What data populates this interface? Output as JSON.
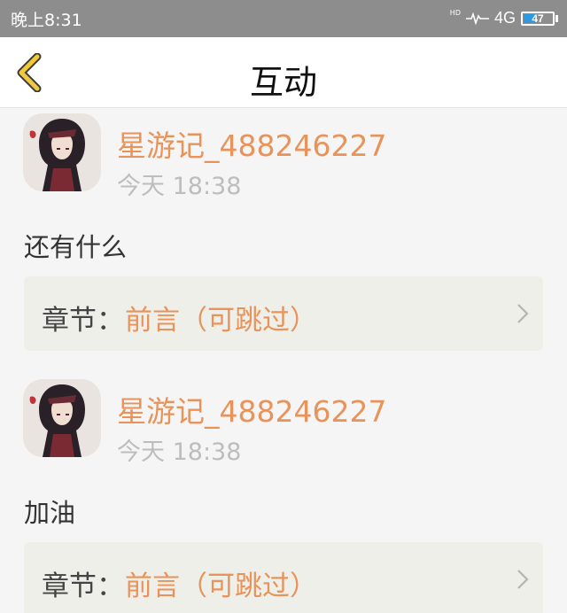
{
  "status_bar": {
    "time": "晚上8:31",
    "hd": "HD",
    "network": "4G",
    "battery_level": "47",
    "battery_fraction": 0.47
  },
  "nav": {
    "title": "互动",
    "back_icon": "chevron-left-icon",
    "accent_color": "#f0c93a"
  },
  "comments": [
    {
      "username": "星游记_488246227",
      "time": "今天 18:38",
      "text": "还有什么",
      "chapter_label": "章节：",
      "chapter_name": "前言（可跳过）"
    },
    {
      "username": "星游记_488246227",
      "time": "今天 18:38",
      "text": "加油",
      "chapter_label": "章节：",
      "chapter_name": "前言（可跳过）"
    }
  ],
  "colors": {
    "username": "#e8935a",
    "timestamp": "#bdbdbd",
    "card_bg": "#efefea",
    "status_bar_bg": "#8d8d8d"
  }
}
